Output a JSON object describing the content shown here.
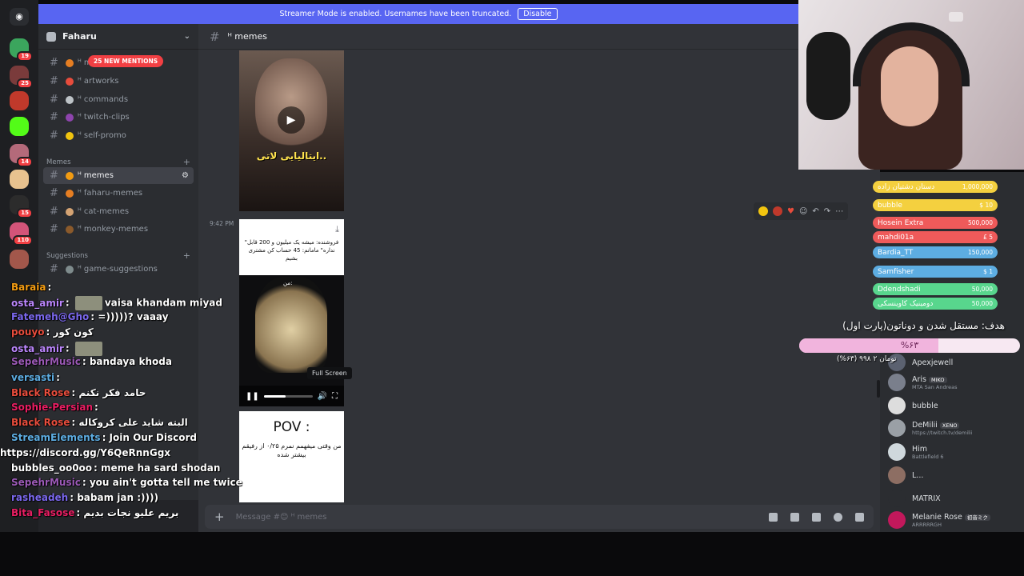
{
  "banner": {
    "text": "Streamer Mode is enabled. Usernames have been truncated.",
    "button": "Disable"
  },
  "rail": {
    "badges": [
      "19",
      "25",
      "14",
      "15",
      "110"
    ]
  },
  "server": {
    "name": "Faharu"
  },
  "mentions_pill": "25 NEW MENTIONS",
  "channels_top": [
    {
      "name": "ᴴ m"
    },
    {
      "name": "ᴴ artworks"
    },
    {
      "name": "ᴴ commands"
    },
    {
      "name": "ᴴ twitch-clips"
    },
    {
      "name": "ᴴ self-promo"
    }
  ],
  "cat_memes": "Memes",
  "channels_memes": [
    {
      "name": "ᴴ memes"
    },
    {
      "name": "ᴴ faharu-memes"
    },
    {
      "name": "ᴴ cat-memes"
    },
    {
      "name": "ᴴ monkey-memes"
    }
  ],
  "cat_suggestions": "Suggestions",
  "channels_suggestions": [
    {
      "name": "ᴴ game-suggestions"
    }
  ],
  "main": {
    "channel": "ᴴ memes",
    "timestamp": "9:42 PM",
    "media1_caption": "ایتالیایی لاتی..",
    "media2_text": "\"فروشنده: میشه یک میلیون و 200 قابل نداره\" مامانم: 45 حساب کن مشتری بشیم",
    "media2_dog_label": "من:",
    "tooltip": "Full Screen",
    "progress": 0.45,
    "media3_title": "POV :",
    "media3_text": "من وقتی میفهمم نمرم ۰/۲۵ از رفیقم بیشتر شده",
    "composer_placeholder": "Message #😊 ᴴ memes"
  },
  "members": [
    {
      "name": "Apexjewell",
      "sub": ""
    },
    {
      "name": "Aris",
      "tag": "MIKO",
      "sub": "MTA San Andreas"
    },
    {
      "name": "bubble",
      "sub": ""
    },
    {
      "name": "DeMilii",
      "tag": "XENO",
      "sub": "https://twitch.tv/demilii"
    },
    {
      "name": "Him",
      "sub": "Battlefield 6"
    },
    {
      "name": "L...",
      "sub": ""
    },
    {
      "name": "MATRIX",
      "sub": ""
    },
    {
      "name": "Melanie Rose",
      "tag": "初音ミク",
      "sub": "ARRRRRGH"
    }
  ],
  "donations": [
    {
      "name": "دستان دشتیان زاده",
      "amount": "1,000,000",
      "color": "#f4d03f"
    },
    {
      "name": "bubble",
      "amount": "$ 10",
      "color": "#f4d03f"
    },
    {
      "name": "Hosein Extra",
      "amount": "500,000",
      "color": "#ef5a5a"
    },
    {
      "name": "mahdi01a",
      "amount": "£ 5",
      "color": "#ef5a5a"
    },
    {
      "name": "Bardia_TT",
      "amount": "150,000",
      "color": "#5dade2"
    },
    {
      "name": "Samfisher",
      "amount": "$ 1",
      "color": "#5dade2"
    },
    {
      "name": "Ddendshadi",
      "amount": "50,000",
      "color": "#58d68d"
    },
    {
      "name": "دومینیک کاوینسکی",
      "amount": "50,000",
      "color": "#58d68d"
    }
  ],
  "goal": {
    "title": "هدف: مستقل شدن و دوناتون(پارت اول)",
    "percent_label": "%۶۳",
    "percent": 0.63,
    "sub": "(%۶۳) تومان ۲ ۹۹۸"
  },
  "chat": [
    {
      "user": "Baraia",
      "msg": "",
      "color": "#f39c12"
    },
    {
      "user": "osta_amir",
      "msg": "vaisa khandam miyad",
      "color": "#bb86fc",
      "emote": true
    },
    {
      "user": "Fatemeh@Gho",
      "msg": "=)))))? vaaay",
      "color": "#7b68ee"
    },
    {
      "user": "pouyo",
      "msg": "کون کور",
      "color": "#e74c3c"
    },
    {
      "user": "osta_amir",
      "msg": "",
      "color": "#bb86fc",
      "emote": true
    },
    {
      "user": "SepehrMusic",
      "msg": "bandaya khoda",
      "color": "#9b59b6"
    },
    {
      "user": "versasti",
      "msg": "",
      "color": "#5dade2"
    },
    {
      "user": "Black Rose",
      "msg": "حامد فکر نکنم",
      "color": "#e74c3c"
    },
    {
      "user": "Sophie-Persian",
      "msg": "",
      "color": "#e91e63"
    },
    {
      "user": "Black Rose",
      "msg": "البته شاید علی کروکاله",
      "color": "#e74c3c"
    },
    {
      "user": "StreamElements",
      "msg": "Join Our Discord",
      "color": "#5dade2"
    },
    {
      "user": "",
      "msg": "https://discord.gg/Y6QeRnnGgx",
      "color": "#ffffff"
    },
    {
      "user": "bubbles_oo0oo",
      "msg": "meme ha sard shodan",
      "color": "#ffffff"
    },
    {
      "user": "SepehrMusic",
      "msg": "you ain't gotta tell me twice",
      "color": "#9b59b6"
    },
    {
      "user": "rasheadeh",
      "msg": "babam jan :))))",
      "color": "#7b68ee"
    },
    {
      "user": "Bita_Fasose",
      "msg": "بریم علیو نجات بدیم",
      "color": "#e91e63"
    }
  ]
}
